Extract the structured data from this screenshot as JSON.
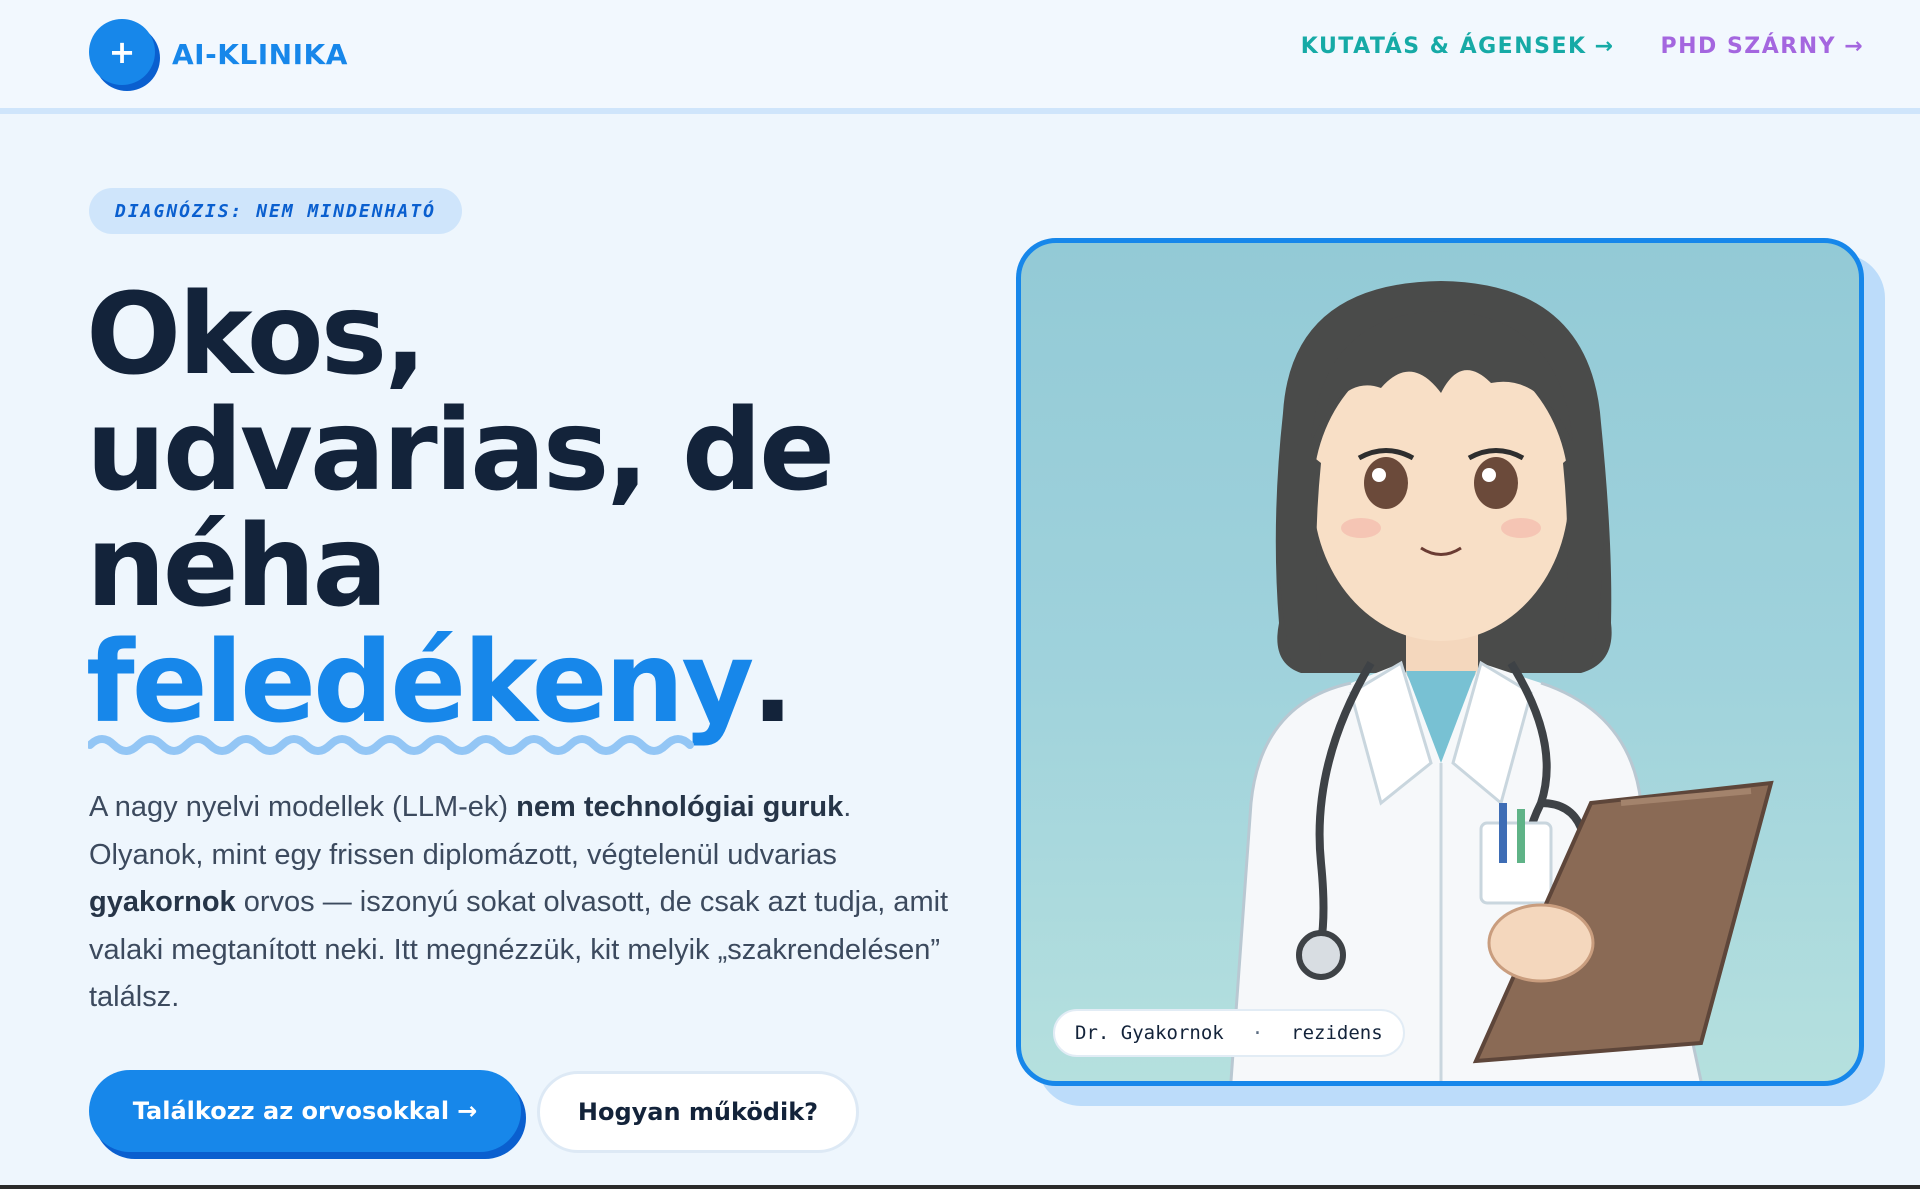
{
  "header": {
    "brand": "AI-KLINIKA",
    "logo_symbol": "+",
    "nav": [
      {
        "label": "KUTATÁS & ÁGENSEK",
        "arrow": "→",
        "color": "#16aaa6"
      },
      {
        "label": "PHD SZÁRNY",
        "arrow": "→",
        "color": "#a466df"
      }
    ]
  },
  "hero": {
    "badge": "DIAGNÓZIS: NEM MINDENHATÓ",
    "headline": {
      "line1": "Okos,",
      "line2": "udvarias, de",
      "line3": "néha",
      "accent": "feledékeny",
      "end": "."
    },
    "lead": {
      "p1": "A nagy nyelvi modellek (LLM-ek) ",
      "b1": "nem technológiai guruk",
      "p2": ". Olyanok, mint egy frissen diplomázott, végtelenül udvarias ",
      "b2": "gyakornok",
      "p3": " orvos — iszonyú sokat olvasott, de csak azt tudja, amit valaki megtanított neki. Itt megnézzük, kit melyik „szakrendelésen” találsz."
    },
    "primary_button": {
      "label": "Találkozz az orvosokkal",
      "arrow": "→"
    },
    "secondary_button": {
      "label": "Hogyan működik?"
    },
    "portrait": {
      "caption_name": "Dr. Gyakornok",
      "caption_sep": "·",
      "caption_role": "rezidens"
    }
  },
  "colors": {
    "accent": "#1787ea",
    "accent_dark": "#0a5fcf",
    "text": "#13233a",
    "background": "#eef6fd"
  },
  "icons": [
    "plus-icon",
    "arrow-right-icon"
  ]
}
